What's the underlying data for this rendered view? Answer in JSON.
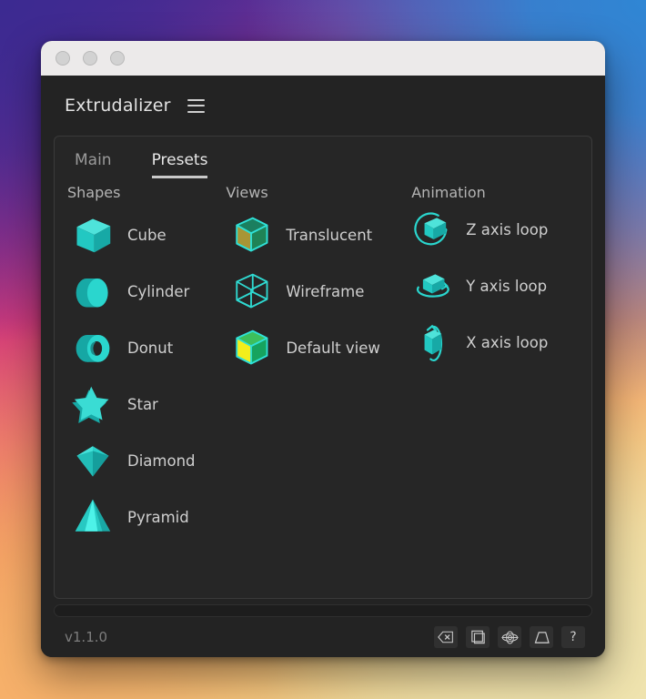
{
  "window": {
    "app_title": "Extrudalizer",
    "menu_icon": "hamburger-menu-icon",
    "traffic_lights": [
      "close-dot",
      "minimize-dot",
      "maximize-dot"
    ]
  },
  "tabs": [
    {
      "label": "Main",
      "active": false
    },
    {
      "label": "Presets",
      "active": true
    }
  ],
  "columns": {
    "shapes": {
      "heading": "Shapes",
      "items": [
        {
          "label": "Cube",
          "icon": "cube-icon"
        },
        {
          "label": "Cylinder",
          "icon": "cylinder-icon"
        },
        {
          "label": "Donut",
          "icon": "donut-torus-icon"
        },
        {
          "label": "Star",
          "icon": "star-icon"
        },
        {
          "label": "Diamond",
          "icon": "diamond-icon"
        },
        {
          "label": "Pyramid",
          "icon": "pyramid-icon"
        }
      ]
    },
    "views": {
      "heading": "Views",
      "items": [
        {
          "label": "Translucent",
          "icon": "translucent-cube-icon"
        },
        {
          "label": "Wireframe",
          "icon": "wireframe-cube-icon"
        },
        {
          "label": "Default view",
          "icon": "solid-cube-icon"
        }
      ]
    },
    "animation": {
      "heading": "Animation",
      "items": [
        {
          "label": "Z axis loop",
          "icon": "z-axis-loop-icon"
        },
        {
          "label": "Y axis loop",
          "icon": "y-axis-loop-icon"
        },
        {
          "label": "X axis loop",
          "icon": "x-axis-loop-icon"
        }
      ]
    }
  },
  "statusbar": {
    "version": "v1.1.0",
    "icons": [
      {
        "name": "erase-backspace-icon",
        "glyph": ""
      },
      {
        "name": "duplicate-cube-icon",
        "glyph": ""
      },
      {
        "name": "orbit-gizmo-icon",
        "glyph": ""
      },
      {
        "name": "perspective-frustum-icon",
        "glyph": ""
      },
      {
        "name": "help-question-icon",
        "glyph": "?"
      }
    ]
  },
  "colors": {
    "accent_cyan": "#25d0c8",
    "cube_light": "#3fe0d8",
    "cube_dark": "#149e9c",
    "view_yellow": "#f2ee1b",
    "view_green": "#16a35e",
    "panel_bg": "#262626",
    "window_bg": "#232323",
    "text_primary": "#e3e3e3",
    "text_secondary": "#cfcfcf",
    "text_muted": "#7d7d7d"
  }
}
